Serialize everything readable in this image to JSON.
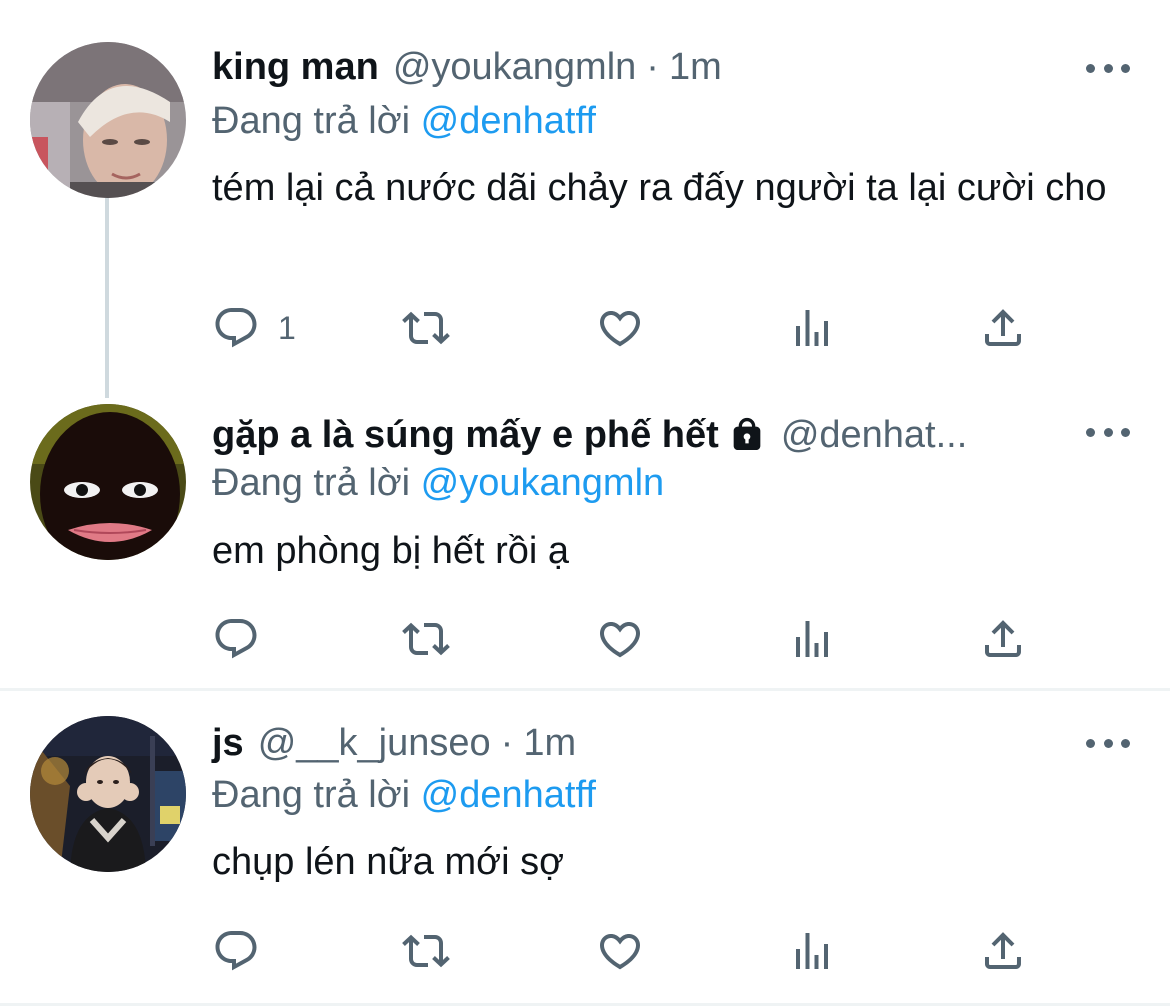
{
  "tweets": [
    {
      "name": "king man",
      "handle": "@youkangmln",
      "dot": "·",
      "time": "1m",
      "reply_prefix": "Đang trả lời",
      "reply_to": "@denhatff",
      "text": "tém lại cả nước dãi chảy ra đấy người ta lại cười cho",
      "reply_count": "1"
    },
    {
      "name": "gặp a là súng mấy e phế hết",
      "handle": "@denhat...",
      "reply_prefix": "Đang trả lời",
      "reply_to": "@youkangmln",
      "text": "em phòng bị hết rồi ạ",
      "locked": true
    },
    {
      "name": "js",
      "handle": "@__k_junseo",
      "dot": "·",
      "time": "1m",
      "reply_prefix": "Đang trả lời",
      "reply_to": "@denhatff",
      "text": "chụp lén nữa mới sợ"
    }
  ],
  "icons": {
    "reply": "reply-icon",
    "retweet": "retweet-icon",
    "like": "heart-icon",
    "views": "analytics-icon",
    "share": "share-icon",
    "more": "more-icon",
    "lock": "lock-icon"
  },
  "colors": {
    "text": "#0f1419",
    "secondary": "#536471",
    "link": "#1d9bf0",
    "divider": "#eff3f4",
    "thread_line": "#cfd9de"
  }
}
